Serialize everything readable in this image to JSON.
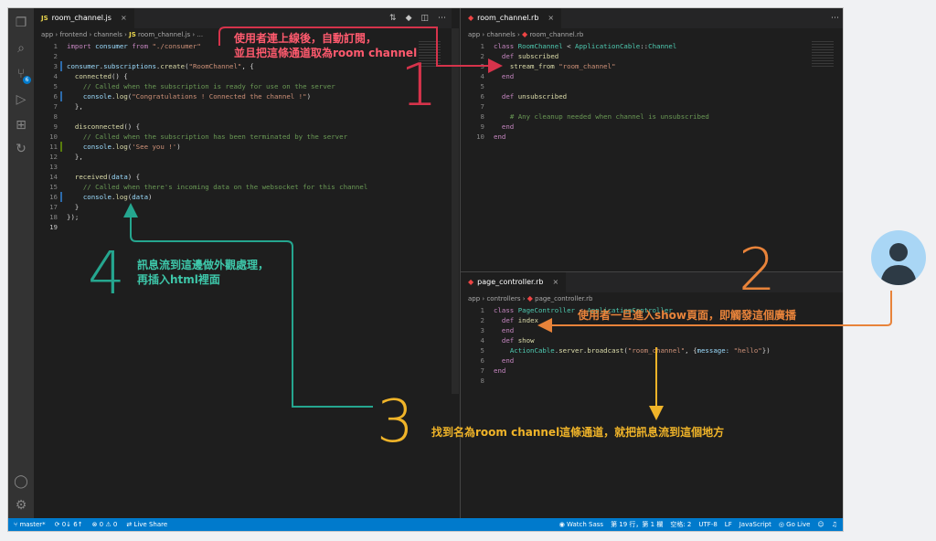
{
  "left": {
    "tab": {
      "badge": "JS",
      "label": "room_channel.js",
      "close": "×"
    },
    "breadcrumb": [
      "app",
      "frontend",
      "channels",
      "JS",
      "room_channel.js",
      "..."
    ],
    "lines": [
      {
        "n": "1",
        "html": "<span class='k'>import</span> <span class='v'>consumer</span> <span class='k'>from</span> <span class='s'>\"./consumer\"</span>"
      },
      {
        "n": "2",
        "html": ""
      },
      {
        "n": "3",
        "html": "<span class='v'>consumer</span>.<span class='v'>subscriptions</span>.<span class='f'>create</span>(<span class='s'>\"RoomChannel\"</span>, {"
      },
      {
        "n": "4",
        "html": "  <span class='f'>connected</span>() {"
      },
      {
        "n": "5",
        "html": "    <span class='c'>// Called when the subscription is ready for use on the server</span>"
      },
      {
        "n": "6",
        "html": "    <span class='v'>console</span>.<span class='f'>log</span>(<span class='s'>\"Congratulations ! Connected the channel !\"</span>)"
      },
      {
        "n": "7",
        "html": "  },"
      },
      {
        "n": "8",
        "html": ""
      },
      {
        "n": "9",
        "html": "  <span class='f'>disconnected</span>() {"
      },
      {
        "n": "10",
        "html": "    <span class='c'>// Called when the subscription has been terminated by the server</span>"
      },
      {
        "n": "11",
        "html": "    <span class='v'>console</span>.<span class='f'>log</span>(<span class='s'>'See you !'</span>)"
      },
      {
        "n": "12",
        "html": "  },"
      },
      {
        "n": "13",
        "html": ""
      },
      {
        "n": "14",
        "html": "  <span class='f'>received</span>(<span class='v'>data</span>) {"
      },
      {
        "n": "15",
        "html": "    <span class='c'>// Called when there's incoming data on the websocket for this channel</span>"
      },
      {
        "n": "16",
        "html": "    <span class='v'>console</span>.<span class='f'>log</span>(<span class='v'>data</span>)"
      },
      {
        "n": "17",
        "html": "  }"
      },
      {
        "n": "18",
        "html": "});"
      },
      {
        "n": "19",
        "html": ""
      }
    ]
  },
  "right_top": {
    "tab": {
      "label": "room_channel.rb",
      "close": "×"
    },
    "breadcrumb": [
      "app",
      "channels",
      "room_channel.rb"
    ],
    "lines": [
      {
        "n": "1",
        "html": "<span class='k'>class</span> <span class='t'>RoomChannel</span> &lt; <span class='t'>ApplicationCable</span>::<span class='t'>Channel</span>"
      },
      {
        "n": "2",
        "html": "  <span class='k'>def</span> <span class='f'>subscribed</span>"
      },
      {
        "n": "3",
        "html": "    <span class='f'>stream_from</span> <span class='s'>\"room_channel\"</span>"
      },
      {
        "n": "4",
        "html": "  <span class='k'>end</span>"
      },
      {
        "n": "5",
        "html": ""
      },
      {
        "n": "6",
        "html": "  <span class='k'>def</span> <span class='f'>unsubscribed</span>"
      },
      {
        "n": "7",
        "html": ""
      },
      {
        "n": "8",
        "html": "    <span class='c'># Any cleanup needed when channel is unsubscribed</span>"
      },
      {
        "n": "9",
        "html": "  <span class='k'>end</span>"
      },
      {
        "n": "10",
        "html": "<span class='k'>end</span>"
      }
    ]
  },
  "right_bottom": {
    "tab": {
      "label": "page_controller.rb",
      "close": "×"
    },
    "breadcrumb": [
      "app",
      "controllers",
      "page_controller.rb"
    ],
    "lines": [
      {
        "n": "1",
        "html": "<span class='k'>class</span> <span class='t'>PageController</span> &lt; <span class='t'>ApplicationController</span>"
      },
      {
        "n": "2",
        "html": "  <span class='k'>def</span> <span class='f'>index</span>"
      },
      {
        "n": "3",
        "html": "  <span class='k'>end</span>"
      },
      {
        "n": "4",
        "html": "  <span class='k'>def</span> <span class='f'>show</span>"
      },
      {
        "n": "5",
        "html": "    <span class='t'>ActionCable</span>.<span class='f'>server</span>.<span class='f'>broadcast</span>(<span class='s'>\"room_channel\"</span>, {<span class='v'>message:</span> <span class='s'>\"hello\"</span>})"
      },
      {
        "n": "6",
        "html": "  <span class='k'>end</span>"
      },
      {
        "n": "7",
        "html": "<span class='k'>end</span>"
      },
      {
        "n": "8",
        "html": ""
      }
    ]
  },
  "statusbar": {
    "branch": "master*",
    "sync": "0↓ 6↑",
    "problems": "⊗ 0 ⚠ 0",
    "live_share": "Live Share",
    "watch_sass": "Watch Sass",
    "position": "第 19 行，第 1 欄",
    "spaces": "空格: 2",
    "encoding": "UTF-8",
    "eol": "LF",
    "language": "JavaScript",
    "go_live": "Go Live"
  },
  "annotations": {
    "step1": {
      "num": "1",
      "text": "使用者連上線後，自動訂閱，\n並且把這條通道取為room channel",
      "color": "#d6334b"
    },
    "step2": {
      "num": "2",
      "text": "使用者一旦進入show頁面，即觸發這個廣播",
      "color": "#e8833a"
    },
    "step3": {
      "num": "3",
      "text": "找到名為room channel這條通道，就把訊息流到這個地方",
      "color": "#f0b429"
    },
    "step4": {
      "num": "4",
      "text": "訊息流到這邊做外觀處理，\n再插入html裡面",
      "color": "#25a68f"
    }
  }
}
